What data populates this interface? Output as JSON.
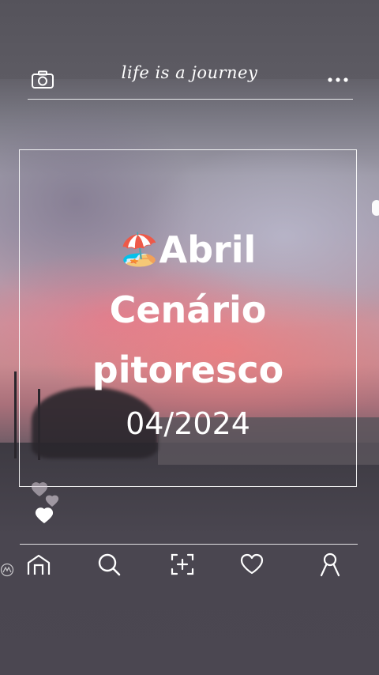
{
  "header": {
    "title": "life is a journey",
    "left_icon": "camera-icon",
    "right_icon": "more-dots-icon"
  },
  "card": {
    "emoji": "🏖️",
    "line1": "Abril",
    "line2": "Cenário",
    "line3": "pitoresco",
    "date": "04/2024"
  },
  "nav": {
    "items": [
      {
        "name": "home",
        "icon": "home-icon"
      },
      {
        "name": "search",
        "icon": "search-icon"
      },
      {
        "name": "add",
        "icon": "add-photo-icon"
      },
      {
        "name": "likes",
        "icon": "heart-icon"
      },
      {
        "name": "profile",
        "icon": "profile-icon"
      }
    ]
  },
  "colors": {
    "foreground": "#ffffff",
    "sky_pink": "#c98a90",
    "sky_gray": "#9d9aa8"
  }
}
